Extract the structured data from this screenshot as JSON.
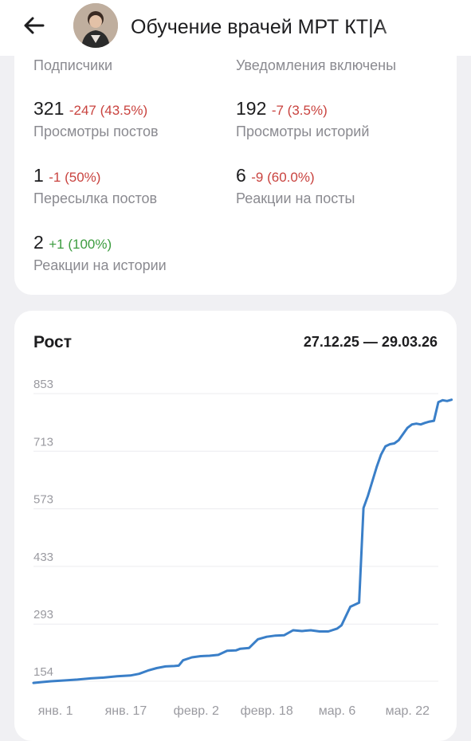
{
  "header": {
    "back_icon": "arrow-left-icon",
    "title": "Обучение врачей МРТ КТ|А"
  },
  "overview": {
    "subscribers_label": "Подписчики",
    "notifications_label": "Уведомления включены",
    "stats": [
      {
        "value": "321",
        "delta": "-247 (43.5%)",
        "trend": "negative",
        "label": "Просмотры постов"
      },
      {
        "value": "192",
        "delta": "-7 (3.5%)",
        "trend": "negative",
        "label": "Просмотры историй"
      },
      {
        "value": "1",
        "delta": "-1 (50%)",
        "trend": "negative",
        "label": "Пересылка постов"
      },
      {
        "value": "6",
        "delta": "-9 (60.0%)",
        "trend": "negative",
        "label": "Реакции на посты"
      },
      {
        "value": "2",
        "delta": "+1 (100%)",
        "trend": "positive",
        "label": "Реакции на истории"
      }
    ]
  },
  "growth": {
    "title": "Рост",
    "date_range": "27.12.25 — 29.03.26"
  },
  "colors": {
    "negative": "#c9433f",
    "positive": "#3c9c3f",
    "line": "#3a7fc8"
  },
  "chart_data": {
    "type": "line",
    "y_ticks": [
      154,
      293,
      433,
      573,
      713,
      853
    ],
    "x_ticks": [
      "янв. 1",
      "янв. 17",
      "февр. 2",
      "февр. 18",
      "мар. 6",
      "мар. 22"
    ],
    "x_tick_days": [
      5,
      21,
      37,
      53,
      69,
      85
    ],
    "x_range_days": [
      0,
      92
    ],
    "ylim": [
      154,
      853
    ],
    "grid": true,
    "series": [
      {
        "points": [
          [
            0,
            150
          ],
          [
            2,
            152
          ],
          [
            4,
            154
          ],
          [
            7,
            156
          ],
          [
            10,
            158
          ],
          [
            13,
            161
          ],
          [
            16,
            163
          ],
          [
            19,
            166
          ],
          [
            22,
            168
          ],
          [
            24,
            172
          ],
          [
            26,
            180
          ],
          [
            28,
            186
          ],
          [
            30,
            190
          ],
          [
            32,
            191
          ],
          [
            33,
            192
          ],
          [
            34,
            205
          ],
          [
            36,
            212
          ],
          [
            38,
            215
          ],
          [
            40,
            216
          ],
          [
            42,
            218
          ],
          [
            44,
            228
          ],
          [
            46,
            229
          ],
          [
            47,
            233
          ],
          [
            49,
            235
          ],
          [
            51,
            256
          ],
          [
            53,
            262
          ],
          [
            55,
            265
          ],
          [
            57,
            266
          ],
          [
            59,
            278
          ],
          [
            61,
            276
          ],
          [
            63,
            278
          ],
          [
            65,
            275
          ],
          [
            67,
            275
          ],
          [
            69,
            282
          ],
          [
            70,
            290
          ],
          [
            72,
            335
          ],
          [
            74,
            345
          ],
          [
            75,
            575
          ],
          [
            76,
            605
          ],
          [
            77,
            640
          ],
          [
            78,
            675
          ],
          [
            79,
            705
          ],
          [
            80,
            725
          ],
          [
            81,
            730
          ],
          [
            82,
            732
          ],
          [
            83,
            740
          ],
          [
            84,
            755
          ],
          [
            85,
            770
          ],
          [
            86,
            778
          ],
          [
            87,
            780
          ],
          [
            88,
            778
          ],
          [
            89,
            782
          ],
          [
            90,
            785
          ],
          [
            91,
            787
          ],
          [
            92,
            832
          ],
          [
            93,
            837
          ],
          [
            94,
            835
          ],
          [
            95,
            838
          ]
        ]
      }
    ]
  }
}
